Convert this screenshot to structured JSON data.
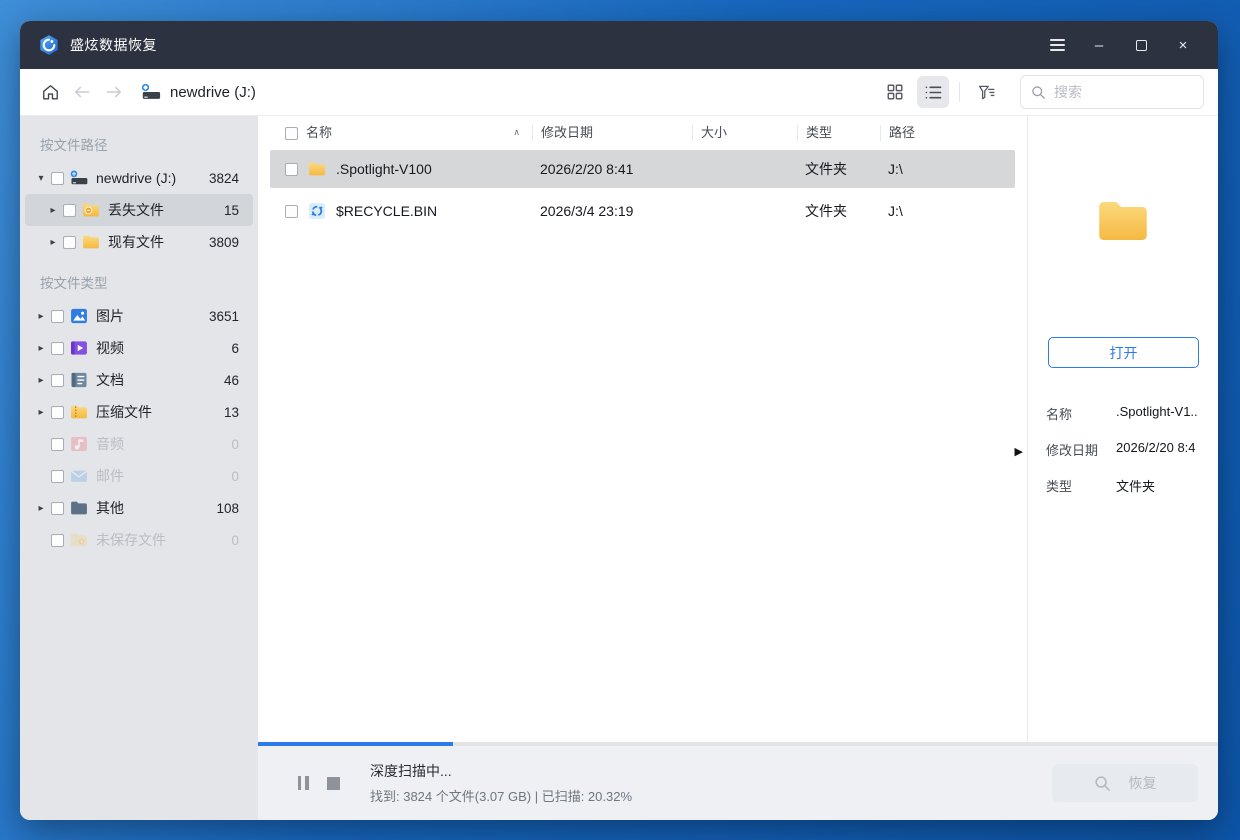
{
  "window": {
    "title": "盛炫数据恢复",
    "controls": {
      "minimize": "–",
      "close": "×"
    }
  },
  "toolbar": {
    "breadcrumb": "newdrive (J:)",
    "search_placeholder": "搜索"
  },
  "icons": {
    "expand_open": "▾",
    "expand_closed": "▸",
    "panel_handle": "▶",
    "sort_asc": "∧"
  },
  "sidebar": {
    "section_path": "按文件路径",
    "section_type": "按文件类型",
    "path_tree": [
      {
        "label": "newdrive (J:)",
        "count": "3824"
      },
      {
        "label": "丢失文件",
        "count": "15"
      },
      {
        "label": "现有文件",
        "count": "3809"
      }
    ],
    "types": [
      {
        "label": "图片",
        "count": "3651"
      },
      {
        "label": "视频",
        "count": "6"
      },
      {
        "label": "文档",
        "count": "46"
      },
      {
        "label": "压缩文件",
        "count": "13"
      },
      {
        "label": "音频",
        "count": "0"
      },
      {
        "label": "邮件",
        "count": "0"
      },
      {
        "label": "其他",
        "count": "108"
      },
      {
        "label": "未保存文件",
        "count": "0"
      }
    ]
  },
  "filelist": {
    "columns": {
      "name": "名称",
      "modified": "修改日期",
      "size": "大小",
      "type": "类型",
      "path": "路径"
    },
    "rows": [
      {
        "name": ".Spotlight-V100",
        "modified": "2026/2/20 8:41",
        "size": "",
        "type": "文件夹",
        "path": "J:\\"
      },
      {
        "name": "$RECYCLE.BIN",
        "modified": "2026/3/4 23:19",
        "size": "",
        "type": "文件夹",
        "path": "J:\\"
      }
    ]
  },
  "preview": {
    "open_label": "打开",
    "details": [
      {
        "label": "名称",
        "value": ".Spotlight-V1.."
      },
      {
        "label": "修改日期",
        "value": "2026/2/20 8:4"
      },
      {
        "label": "类型",
        "value": "文件夹"
      }
    ]
  },
  "statusbar": {
    "status_line": "深度扫描中...",
    "detail_line": "找到: 3824 个文件(3.07 GB) | 已扫描: 20.32%",
    "progress_percent": 20.32,
    "recover_label": "恢复"
  },
  "colors": {
    "accent": "#2b7cea",
    "titlebar": "#2c323f",
    "desktop": "#1767be"
  }
}
